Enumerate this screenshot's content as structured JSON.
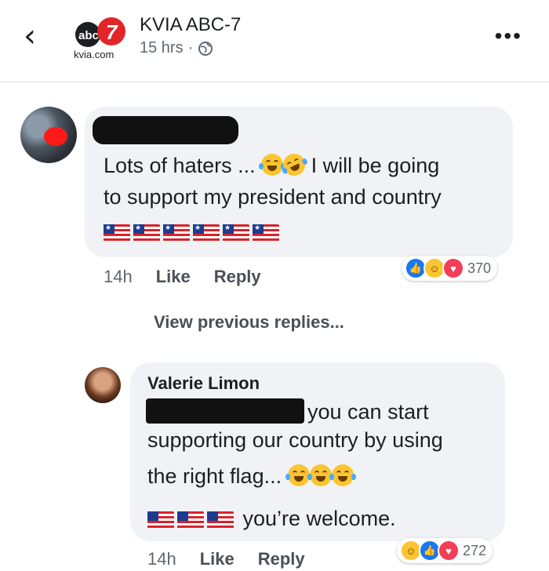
{
  "header": {
    "back_icon": "back-arrow-icon",
    "logo_text_top": "abc",
    "logo_number": "7",
    "logo_text_bottom": "kvia.com",
    "page_name": "KVIA ABC-7",
    "time": "15 hrs",
    "separator": "·",
    "privacy_icon": "globe-icon",
    "more_label": "•••"
  },
  "comment1": {
    "text_line1": "Lots of haters ...",
    "text_line1b": "I will be going",
    "text_line2": "to support my president and country",
    "time": "14h",
    "like_label": "Like",
    "reply_label": "Reply",
    "reaction_count": "370"
  },
  "view_previous": "View previous replies...",
  "reply1": {
    "author": "Valerie Limon",
    "text_line1": "you can start",
    "text_line2": "supporting our country by using",
    "text_line3": "the right flag...",
    "text_line4": "you’re welcome.",
    "time": "14h",
    "like_label": "Like",
    "reply_label": "Reply",
    "reaction_count": "272"
  },
  "colors": {
    "bubble": "#f0f2f5",
    "link": "#4b4f56",
    "like": "#1877f2",
    "love": "#f33e58"
  }
}
